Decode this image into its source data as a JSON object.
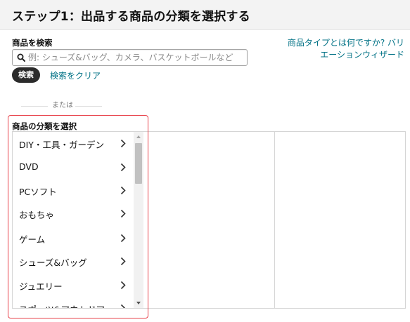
{
  "header": {
    "title": "ステップ1：出品する商品の分類を選択する"
  },
  "search": {
    "label": "商品を検索",
    "placeholder": "例: シューズ&バッグ、カメラ、バスケットボールなど",
    "value": "",
    "button_label": "検索",
    "clear_label": "検索をクリア"
  },
  "help": {
    "line1": "商品タイプとは何ですか? バリ",
    "line2": "エーションウィザード"
  },
  "divider": {
    "or_text": "または"
  },
  "category": {
    "label": "商品の分類を選択",
    "items": [
      {
        "label": "DIY・工具・ガーデン"
      },
      {
        "label": "DVD"
      },
      {
        "label": "PCソフト"
      },
      {
        "label": "おもちゃ"
      },
      {
        "label": "ゲーム"
      },
      {
        "label": "シューズ&バッグ"
      },
      {
        "label": "ジュエリー"
      },
      {
        "label": "スポーツ&アウトドア"
      }
    ]
  },
  "colors": {
    "link": "#007185",
    "highlight_border": "#e8424b",
    "search_button_bg": "#2b2b2b",
    "header_bg": "#f3f3f3"
  }
}
